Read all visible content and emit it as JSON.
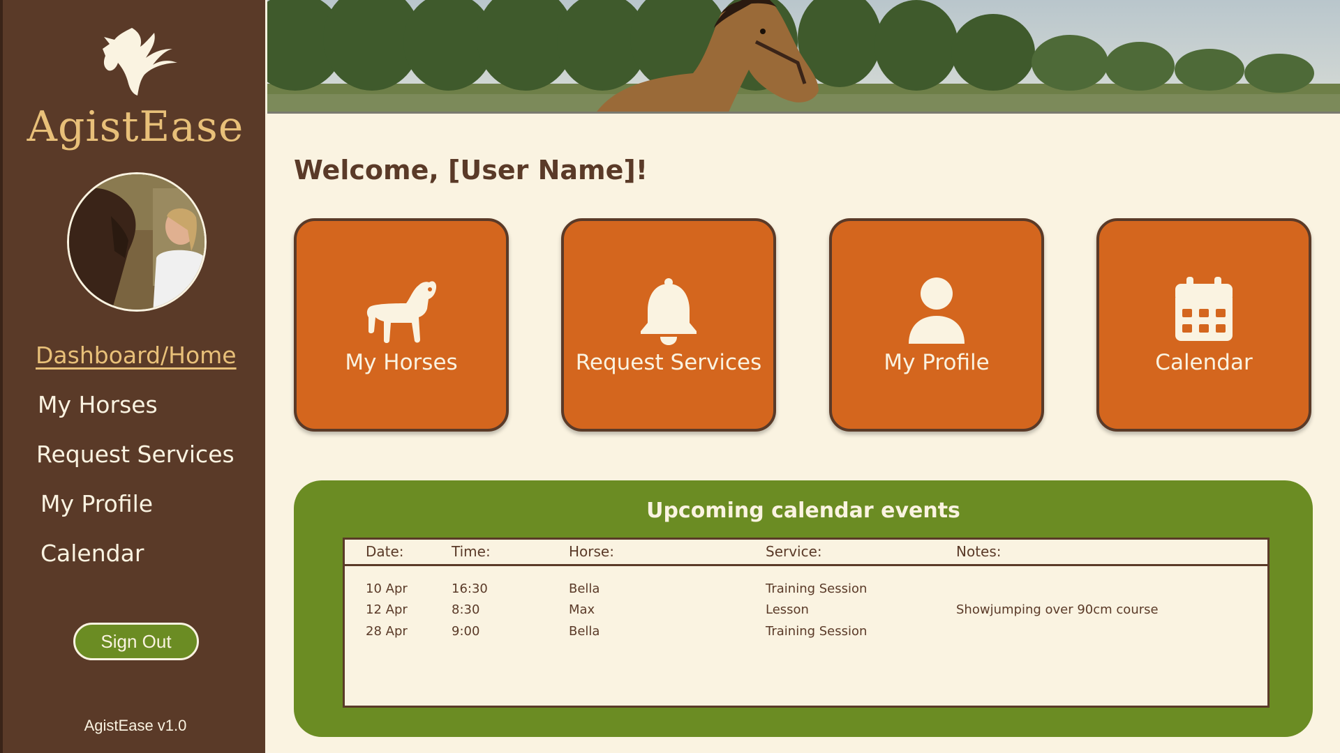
{
  "app": {
    "brand": "AgistEase",
    "version": "AgistEase v1.0"
  },
  "colors": {
    "sidebar": "#5a3a28",
    "accent_gold": "#e8c079",
    "tile_orange": "#d4661e",
    "panel_green": "#6b8c23",
    "background": "#faf3e1"
  },
  "sidebar": {
    "nav": [
      {
        "label": "Dashboard/Home",
        "active": true
      },
      {
        "label": "My Horses",
        "active": false
      },
      {
        "label": "Request Services",
        "active": false
      },
      {
        "label": "My Profile",
        "active": false
      },
      {
        "label": "Calendar",
        "active": false
      }
    ],
    "signout_label": "Sign Out"
  },
  "main": {
    "welcome": "Welcome, [User Name]!",
    "tiles": [
      {
        "label": "My Horses",
        "icon": "horse-icon"
      },
      {
        "label": "Request Services",
        "icon": "bell-icon"
      },
      {
        "label": "My Profile",
        "icon": "user-icon"
      },
      {
        "label": "Calendar",
        "icon": "calendar-icon"
      }
    ],
    "events": {
      "title": "Upcoming calendar events",
      "columns": [
        "Date:",
        "Time:",
        "Horse:",
        "Service:",
        "Notes:"
      ],
      "rows": [
        [
          "10 Apr",
          "16:30",
          "Bella",
          "Training Session",
          ""
        ],
        [
          "12 Apr",
          "8:30",
          "Max",
          "Lesson",
          "Showjumping over 90cm course"
        ],
        [
          "28 Apr",
          "9:00",
          "Bella",
          "Training Session",
          ""
        ]
      ]
    }
  }
}
